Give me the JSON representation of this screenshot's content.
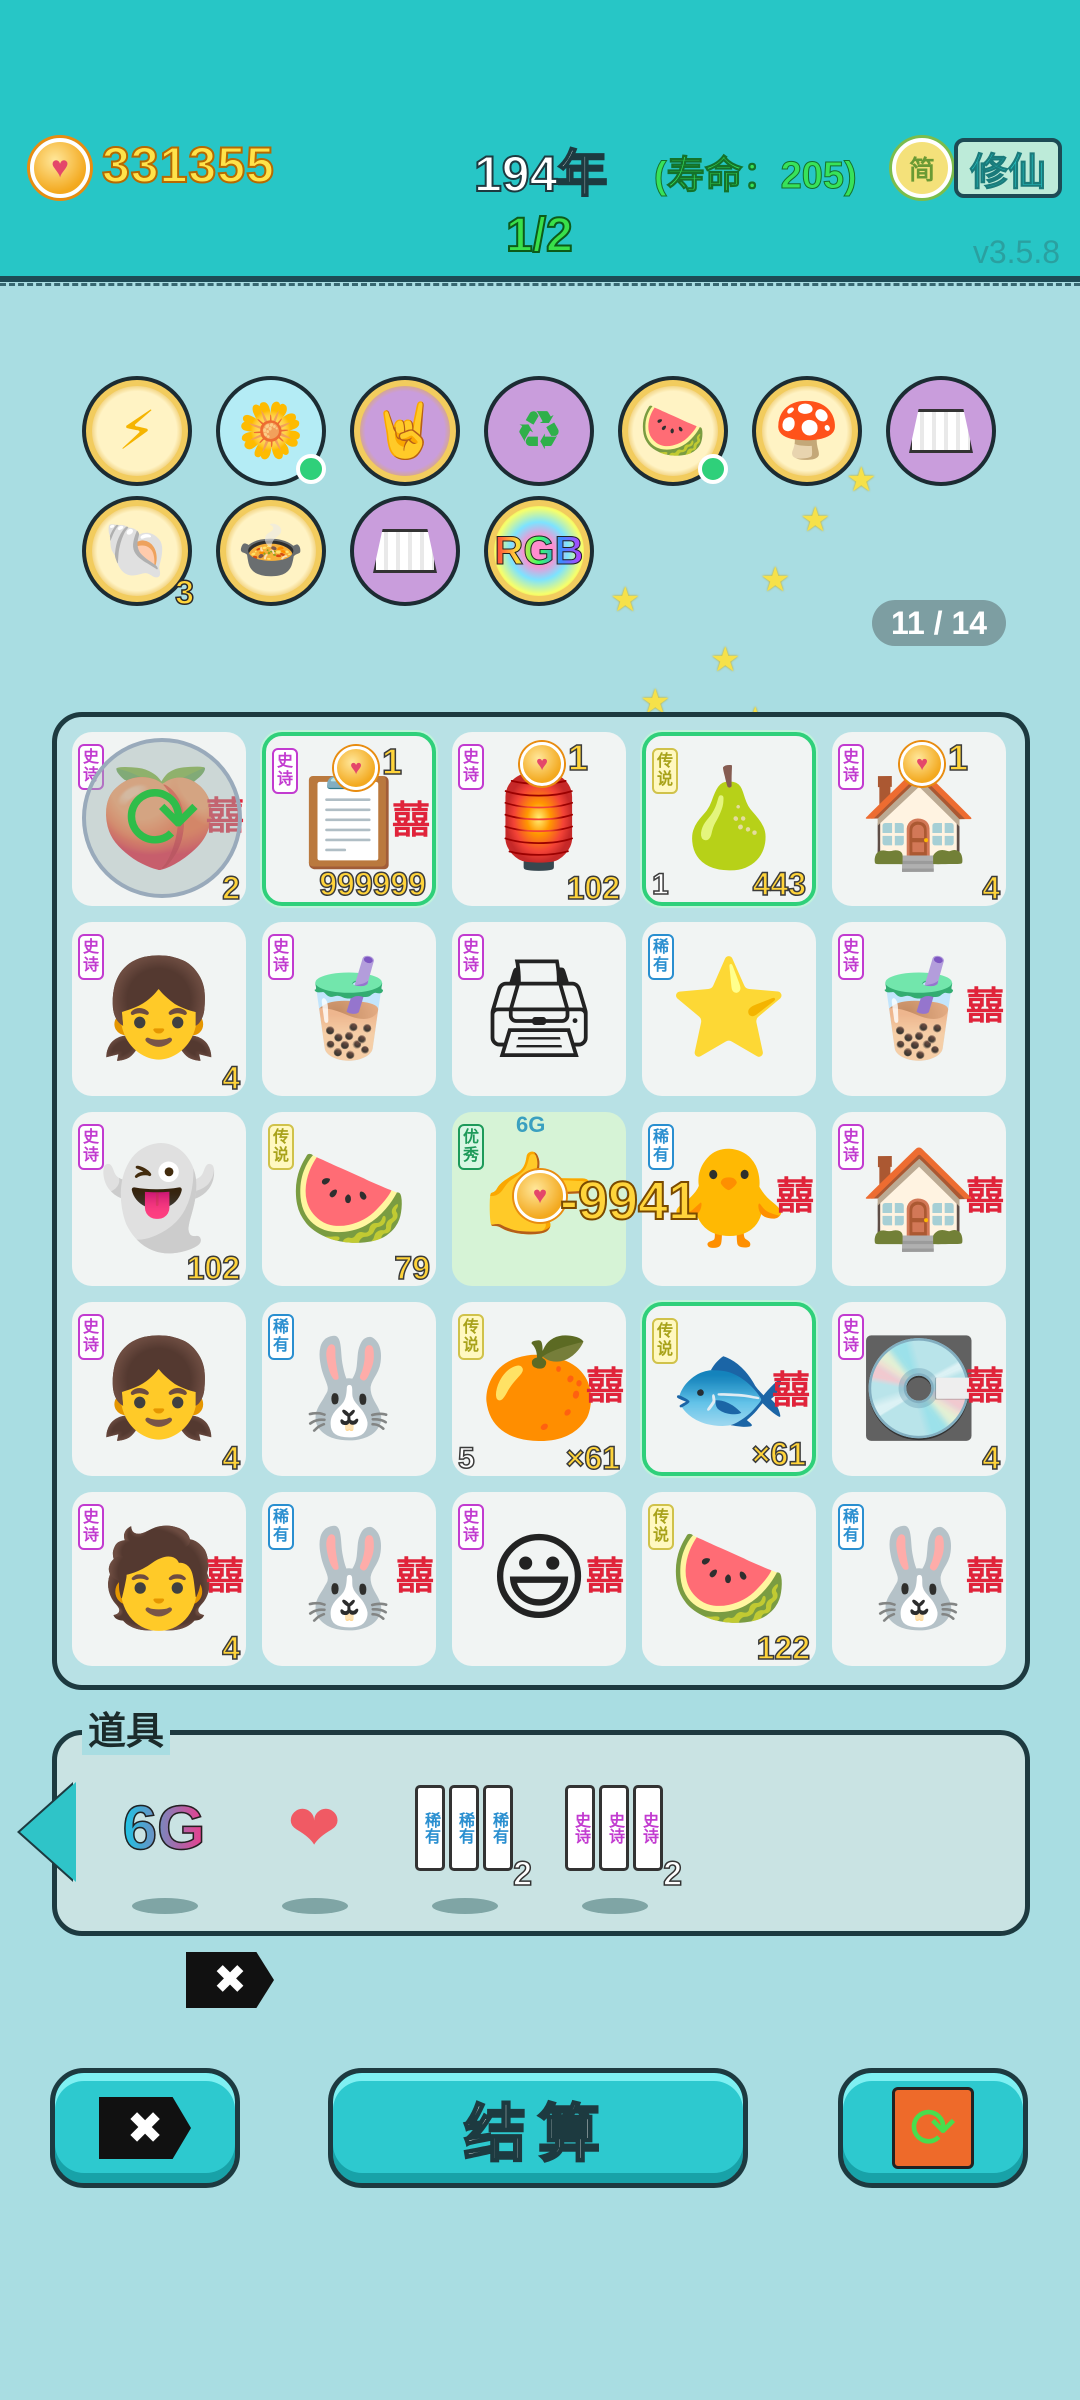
{
  "header": {
    "coins": "331355",
    "year": "194年",
    "lifespan": "(寿命：205)",
    "progress": "1/2",
    "simplified_label": "简",
    "xiuxian_label": "修仙",
    "version": "v3.5.8"
  },
  "relics": {
    "counter": "11 / 14",
    "items": [
      {
        "icon": "lightning-icon",
        "glyph": "⚡"
      },
      {
        "icon": "flower-pot-icon",
        "glyph": "🌼"
      },
      {
        "icon": "rock-hand-icon",
        "glyph": "🤘"
      },
      {
        "icon": "recycle-icon",
        "glyph": "♻"
      },
      {
        "icon": "fruit-basket-icon",
        "glyph": "🍉"
      },
      {
        "icon": "mushroom-cloud-icon",
        "glyph": "🍄"
      },
      {
        "icon": "skirt-icon",
        "glyph": ""
      },
      {
        "icon": "shell-icon",
        "glyph": "🐚",
        "count": "3"
      },
      {
        "icon": "rice-cooker-icon",
        "glyph": "🍲"
      },
      {
        "icon": "skirt-icon",
        "glyph": ""
      },
      {
        "icon": "rgb-icon",
        "glyph": "RGB"
      }
    ]
  },
  "board": {
    "floating_value": "-9941",
    "tiles": [
      {
        "rarity": "史诗",
        "rclass": "epic",
        "glyph": "🍑",
        "count": "2",
        "xi": "囍"
      },
      {
        "rarity": "史诗",
        "rclass": "epic",
        "glyph": "📋",
        "count": "999999",
        "coin_num": "1",
        "xi": "囍",
        "sel": true
      },
      {
        "rarity": "史诗",
        "rclass": "epic",
        "glyph": "🏮",
        "count": "102",
        "coin_num": "1"
      },
      {
        "rarity": "传说",
        "rclass": "legend",
        "glyph": "🍐",
        "count": "443",
        "left": "1",
        "sel": true
      },
      {
        "rarity": "史诗",
        "rclass": "epic",
        "glyph": "🏠",
        "count": "4",
        "coin_num": "1"
      },
      {
        "rarity": "史诗",
        "rclass": "epic",
        "glyph": "👧",
        "count": "4"
      },
      {
        "rarity": "史诗",
        "rclass": "epic",
        "glyph": "🧋",
        "count": ""
      },
      {
        "rarity": "史诗",
        "rclass": "epic",
        "glyph": "🖨",
        "count": ""
      },
      {
        "rarity": "稀有",
        "rclass": "rare",
        "glyph": "⭐",
        "count": ""
      },
      {
        "rarity": "史诗",
        "rclass": "epic",
        "glyph": "🧋",
        "count": "",
        "xi": "囍"
      },
      {
        "rarity": "史诗",
        "rclass": "epic",
        "glyph": "👻",
        "count": "102"
      },
      {
        "rarity": "传说",
        "rclass": "legend",
        "glyph": "🍉",
        "count": "79"
      },
      {
        "rarity": "优秀",
        "rclass": "excellent",
        "glyph": "👉",
        "count": "",
        "tag": "6G",
        "green": true
      },
      {
        "rarity": "稀有",
        "rclass": "rare",
        "glyph": "🐥",
        "count": "",
        "xi": "囍"
      },
      {
        "rarity": "史诗",
        "rclass": "epic",
        "glyph": "🏠",
        "count": "",
        "xi": "囍"
      },
      {
        "rarity": "史诗",
        "rclass": "epic",
        "glyph": "👧",
        "count": "4"
      },
      {
        "rarity": "稀有",
        "rclass": "rare",
        "glyph": "🐰",
        "count": ""
      },
      {
        "rarity": "传说",
        "rclass": "legend",
        "glyph": "🍊",
        "count": "×61",
        "left": "5",
        "xi": "囍"
      },
      {
        "rarity": "传说",
        "rclass": "legend",
        "glyph": "🐟",
        "count": "×61",
        "xi": "囍",
        "sel": true
      },
      {
        "rarity": "史诗",
        "rclass": "epic",
        "glyph": "💽",
        "count": "4",
        "xi": "囍"
      },
      {
        "rarity": "史诗",
        "rclass": "epic",
        "glyph": "🧑",
        "count": "4",
        "xi": "囍"
      },
      {
        "rarity": "稀有",
        "rclass": "rare",
        "glyph": "🐰",
        "count": "",
        "xi": "囍"
      },
      {
        "rarity": "史诗",
        "rclass": "epic",
        "glyph": "😃",
        "count": "",
        "xi": "囍"
      },
      {
        "rarity": "传说",
        "rclass": "legend",
        "glyph": "🍉",
        "count": "122"
      },
      {
        "rarity": "稀有",
        "rclass": "rare",
        "glyph": "🐰",
        "count": "",
        "xi": "囍"
      }
    ]
  },
  "items": {
    "label": "道具",
    "list": [
      {
        "name": "6g-item",
        "text": "6G"
      },
      {
        "name": "liver-item",
        "text": ""
      },
      {
        "name": "rare-cards-item",
        "count": "2",
        "card": "稀有"
      },
      {
        "name": "epic-cards-item",
        "count": "2",
        "card": "史诗"
      }
    ]
  },
  "buttons": {
    "delete_label": "✖",
    "cancel_label": "✖",
    "settle_label": "结算"
  }
}
